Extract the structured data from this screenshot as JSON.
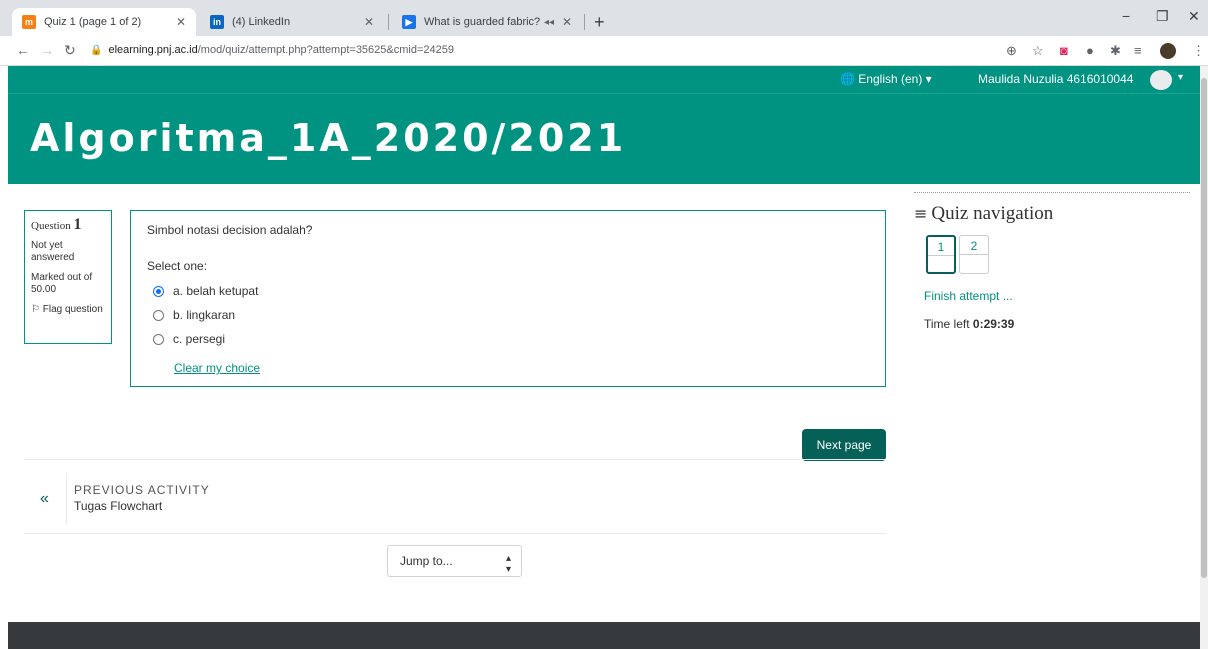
{
  "browser": {
    "tabs": [
      {
        "title": "Quiz 1 (page 1 of 2)",
        "favicon": "moodle-favicon",
        "active": true
      },
      {
        "title": "(4) LinkedIn",
        "favicon": "linkedin-favicon",
        "active": false
      },
      {
        "title": "What is guarded fabric?",
        "favicon": "video-favicon",
        "active": false
      }
    ],
    "url_host": "elearning.pnj.ac.id",
    "url_path": "/mod/quiz/attempt.php?attempt=35625&cmid=24259"
  },
  "topnav": {
    "language": "English (en)",
    "user_name": "Maulida Nuzulia 4616010044"
  },
  "course": {
    "title": "Algoritma_1A_2020/2021"
  },
  "question_info": {
    "label": "Question",
    "number": "1",
    "state": "Not yet answered",
    "marks": "Marked out of 50.00",
    "flag": "Flag question"
  },
  "question": {
    "text": "Simbol notasi decision adalah?",
    "prompt": "Select one:",
    "options": [
      {
        "label": "a. belah ketupat",
        "selected": true
      },
      {
        "label": "b. lingkaran",
        "selected": false
      },
      {
        "label": "c. persegi",
        "selected": false
      }
    ],
    "clear": "Clear my choice"
  },
  "actions": {
    "next": "Next page"
  },
  "activity_nav": {
    "label": "PREVIOUS ACTIVITY",
    "activity": "Tugas Flowchart"
  },
  "jump": {
    "label": "Jump to..."
  },
  "quiz_nav": {
    "title": "Quiz navigation",
    "pages": [
      "1",
      "2"
    ],
    "finish": "Finish attempt ...",
    "time_label": "Time left",
    "time_value": "0:29:39"
  },
  "colors": {
    "brand": "#009381",
    "brand_dark": "#056057",
    "footer": "#373a3c"
  }
}
